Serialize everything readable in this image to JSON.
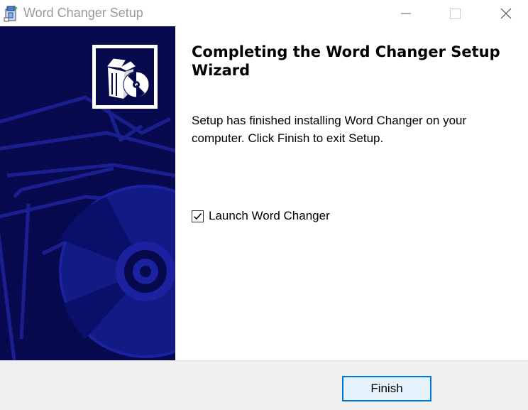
{
  "window": {
    "title": "Word Changer Setup"
  },
  "icons": {
    "app": "installer-icon",
    "minimize": "minimize-icon",
    "maximize": "maximize-icon",
    "close": "close-icon",
    "banner_logo": "setup-box-cd-icon",
    "checkmark": "checkmark-icon"
  },
  "content": {
    "heading": "Completing the Word Changer Setup Wizard",
    "message": "Setup has finished installing Word Changer on your computer. Click Finish to exit Setup.",
    "launch_checkbox": {
      "label": "Launch Word Changer",
      "checked": true
    }
  },
  "footer": {
    "finish_label": "Finish"
  },
  "colors": {
    "banner_bg": "#07094d",
    "banner_art": "#1a1f8f",
    "accent": "#0078d7",
    "button_bg": "#e5f1fb",
    "footer_bg": "#f0f0f0"
  }
}
